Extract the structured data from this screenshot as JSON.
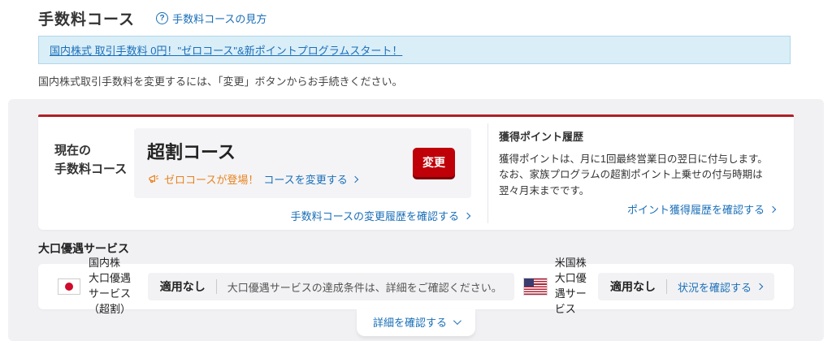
{
  "page": {
    "title": "手数料コース",
    "help_link": "手数料コースの見方",
    "banner_link": "国内株式 取引手数料 0円！\"ゼロコース\"&新ポイントプログラムスタート！",
    "description": "国内株式取引手数料を変更するには、「変更」ボタンからお手続きください。"
  },
  "current_course": {
    "label_line1": "現在の",
    "label_line2": "手数料コース",
    "course_name": "超割コース",
    "promo_text": "ゼロコースが登場！",
    "promo_link": "コースを変更する",
    "change_button": "変更",
    "history_link": "手数料コースの変更履歴を確認する"
  },
  "point_history": {
    "heading": "獲得ポイント履歴",
    "line1": "獲得ポイントは、月に1回最終営業日の翌日に付与します。",
    "line2": "なお、家族プログラムの超割ポイント上乗せの付与時期は翌々月末までです。",
    "link": "ポイント獲得履歴を確認する"
  },
  "large_lot": {
    "heading": "大口優遇サービス",
    "domestic": {
      "market": "国内株",
      "service": "大口優遇サービス（超割）",
      "status": "適用なし",
      "note": "大口優遇サービスの達成条件は、詳細をご確認ください。"
    },
    "us": {
      "market": "米国株",
      "service": "大口優遇サービス",
      "status": "適用なし",
      "link": "状況を確認する"
    },
    "detail_button": "詳細を確認する"
  },
  "colors": {
    "accent_red": "#b01f24",
    "button_red": "#bf0008",
    "link_blue": "#1a6fb8",
    "promo_orange": "#e8821e",
    "banner_bg": "#daeef8"
  }
}
